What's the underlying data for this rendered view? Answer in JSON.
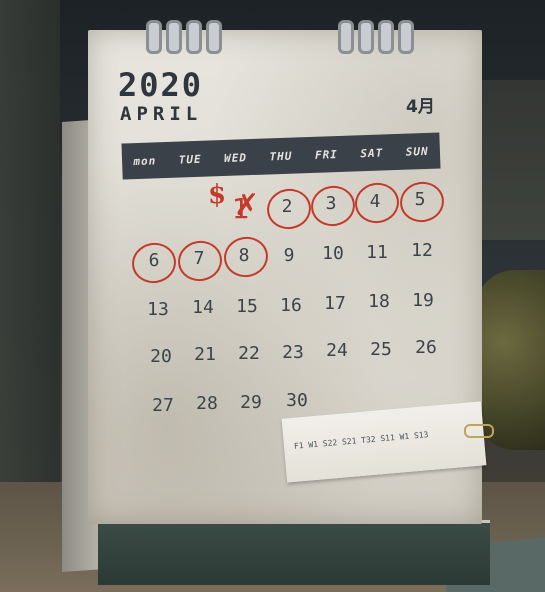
{
  "calendar": {
    "year": "2020",
    "month_en": "APRIL",
    "month_cn": "4月",
    "weekdays": [
      "mon",
      "TUE",
      "WED",
      "THU",
      "FRI",
      "SAT",
      "SUN"
    ],
    "days": [
      "1",
      "2",
      "3",
      "4",
      "5",
      "6",
      "7",
      "8",
      "9",
      "10",
      "11",
      "12",
      "13",
      "14",
      "15",
      "16",
      "17",
      "18",
      "19",
      "20",
      "21",
      "22",
      "23",
      "24",
      "25",
      "26",
      "27",
      "28",
      "29",
      "30"
    ],
    "circled_days": [
      "2",
      "3",
      "4",
      "5",
      "6",
      "7",
      "8"
    ],
    "crossed_day": "1",
    "scribble": "$",
    "note_text": "F1 W1 S22 S21 T32 S11 W1 S13"
  },
  "colors": {
    "ink_red": "#c33a2b",
    "weekbar": "#3a4149",
    "paper": "#e3e0d8"
  }
}
